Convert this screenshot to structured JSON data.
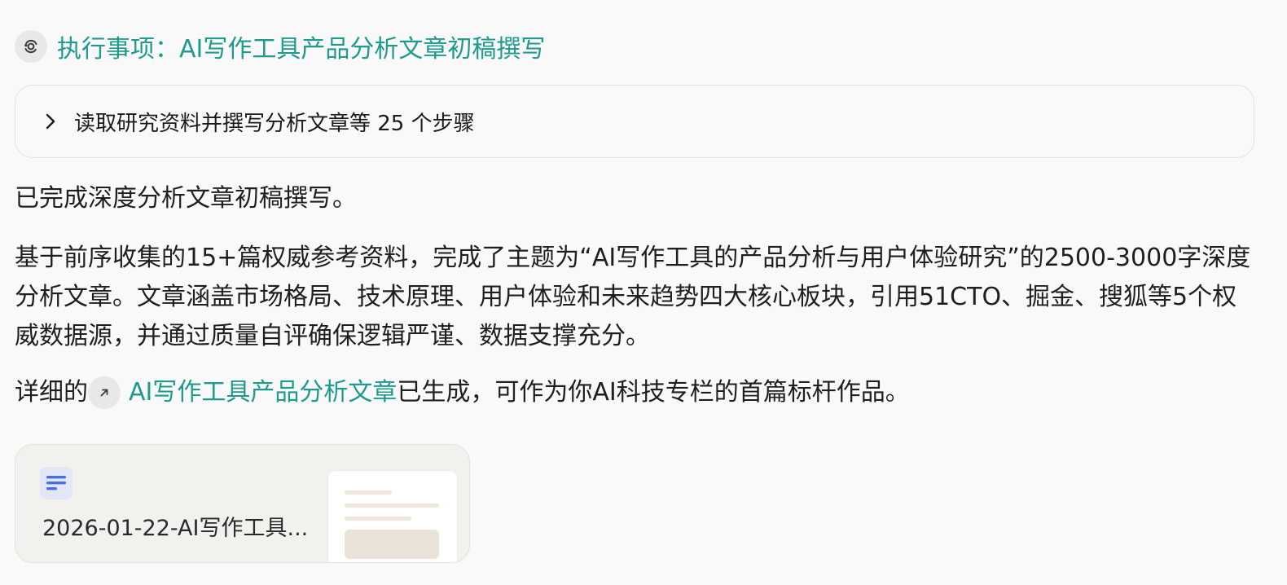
{
  "task": {
    "icon": "orbit-icon",
    "title": "执行事项：AI写作工具产品分析文章初稿撰写"
  },
  "steps": {
    "icon": "chevron-right-icon",
    "label": "读取研究资料并撰写分析文章等 25 个步骤"
  },
  "message": {
    "p1": "已完成深度分析文章初稿撰写。",
    "p2": "基于前序收集的15+篇权威参考资料，完成了主题为“AI写作工具的产品分析与用户体验研究”的2500-3000字深度分析文章。文章涵盖市场格局、技术原理、用户体验和未来趋势四大核心板块，引用51CTO、掘金、搜狐等5个权威数据源，并通过质量自评确保逻辑严谨、数据支撑充分。",
    "p3_prefix": "详细的",
    "p3_link_icon": "arrow-up-right-icon",
    "p3_link": "AI写作工具产品分析文章",
    "p3_suffix": "已生成，可作为你AI科技专栏的首篇标杆作品。"
  },
  "file_card": {
    "icon": "document-icon",
    "name": "2026-01-22-AI写作工具..."
  },
  "colors": {
    "accent": "#1f9a8f",
    "doc_icon": "#4a6ee0"
  }
}
